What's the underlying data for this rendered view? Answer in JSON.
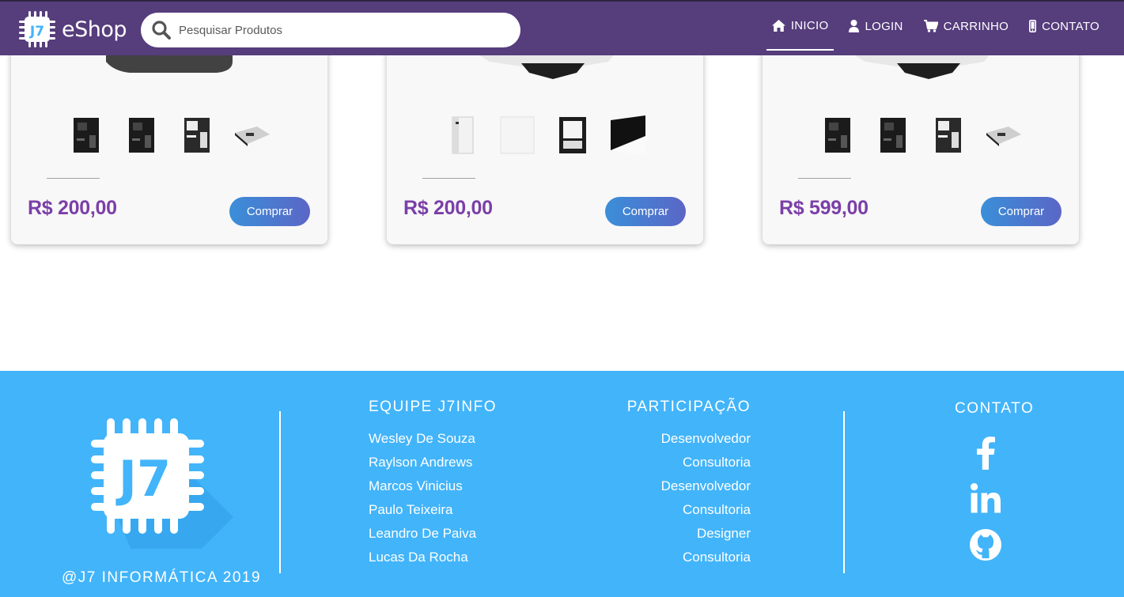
{
  "nav": {
    "brand": "eShop",
    "brand_chip_text": "J7",
    "search_placeholder": "Pesquisar Produtos",
    "items": [
      {
        "label": "INICIO",
        "icon": "home-icon",
        "active": true
      },
      {
        "label": "LOGIN",
        "icon": "user-icon",
        "active": false
      },
      {
        "label": "CARRINHO",
        "icon": "cart-icon",
        "active": false
      },
      {
        "label": "CONTATO",
        "icon": "phone-icon",
        "active": false
      }
    ]
  },
  "products": [
    {
      "price": "R$ 200,00",
      "buy_label": "Comprar",
      "thumbs": [
        "motherboard-black",
        "motherboard-black",
        "motherboard-white",
        "motherboard-flat"
      ]
    },
    {
      "price": "R$ 200,00",
      "buy_label": "Comprar",
      "thumbs": [
        "case-white",
        "case-white-panel",
        "case-black",
        "case-black-side"
      ]
    },
    {
      "price": "R$ 599,00",
      "buy_label": "Comprar",
      "thumbs": [
        "motherboard-black",
        "motherboard-black",
        "motherboard-white",
        "motherboard-flat"
      ]
    }
  ],
  "footer": {
    "copyright": "@J7 INFORMÁTICA 2019",
    "team_title": "EQUIPE J7INFO",
    "team": [
      "Wesley De Souza",
      "Raylson Andrews",
      "Marcos Vinicius",
      "Paulo Teixeira",
      "Leandro De Paiva",
      "Lucas Da Rocha"
    ],
    "roles_title": "PARTICIPAÇÃO",
    "roles": [
      "Desenvolvedor",
      "Consultoria",
      "Desenvolvedor",
      "Consultoria",
      "Designer",
      "Consultoria"
    ],
    "contact_title": "CONTATO",
    "social": [
      "facebook-icon",
      "linkedin-icon",
      "github-icon"
    ]
  },
  "colors": {
    "navbar": "#563d7c",
    "footer": "#42b4fa",
    "price": "#7b3fa8",
    "button_gradient_start": "#3a8fd9",
    "button_gradient_end": "#5b66c6"
  }
}
